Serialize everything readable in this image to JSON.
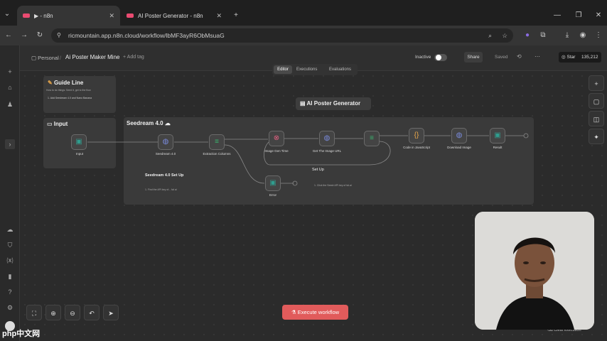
{
  "browser": {
    "tabs": [
      {
        "label": "▶ - n8n",
        "active": true
      },
      {
        "label": "AI Poster Generator - n8n",
        "active": false
      }
    ],
    "url": "ricmountain.app.n8n.cloud/workflow/lbMF3ayR6ObMsuaG"
  },
  "header": {
    "breadcrumb_owner": "Personal",
    "workflow_name": "Ai Poster Maker Mine",
    "add_tag": "+ Add tag",
    "inactive_label": "Inactive",
    "share_label": "Share",
    "saved_label": "Saved",
    "star_label": "Star",
    "star_count": "135,212"
  },
  "view_tabs": [
    "Editor",
    "Executions",
    "Evaluations"
  ],
  "canvas": {
    "guide_title": "Guide Line",
    "guide_text": "How to do things: Seed it, get to the flow",
    "guide_bullet": "1. Add Seedream 4.0 and Nano Banana",
    "input_title": "Input",
    "seedream_title": "Seedream 4.0 ☁",
    "poster_title": "AI Poster Generator",
    "setup_title": "Seedream 4.0 Set Up",
    "setup_bullet": "1. Find the API key of... fal ai",
    "setup2_title": "Set Up",
    "setup2_bullet": "1. Click the Seedr API key of fal.ai",
    "nodes": [
      {
        "id": "input",
        "label": "Input",
        "color": "#2f9e8f"
      },
      {
        "id": "seedream",
        "label": "Seedream 4.0",
        "color": "#7b8cde"
      },
      {
        "id": "extract",
        "label": "Extraction Columns",
        "color": "#3ab56f"
      },
      {
        "id": "imgwait",
        "label": "Image Gen Time",
        "color": "#e06080"
      },
      {
        "id": "getimg",
        "label": "Get The Image URL",
        "color": "#7b8cde"
      },
      {
        "id": "edit",
        "label": "",
        "color": "#3ab56f"
      },
      {
        "id": "code",
        "label": "Code in JavaScript",
        "color": "#e6a54a"
      },
      {
        "id": "download",
        "label": "Download Image",
        "color": "#7b8cde"
      },
      {
        "id": "result",
        "label": "Result",
        "color": "#2f9e8f"
      },
      {
        "id": "error",
        "label": "Error",
        "color": "#2f9e8f"
      }
    ]
  },
  "toolbar": {
    "execute_label": "Execute workflow",
    "clear_label": "Clear execution"
  },
  "watermark": "php中文网"
}
